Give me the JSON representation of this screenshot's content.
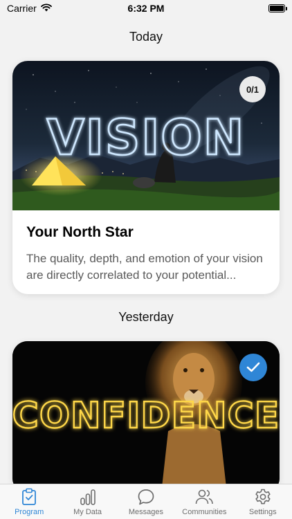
{
  "status_bar": {
    "carrier": "Carrier",
    "time": "6:32 PM"
  },
  "sections": [
    {
      "heading": "Today",
      "card": {
        "image_text": "VISION",
        "badge": "0/1",
        "title": "Your North Star",
        "description": "The quality, depth, and emotion of your vision are directly correlated to your potential..."
      }
    },
    {
      "heading": "Yesterday",
      "card": {
        "image_text": "CONFIDENCE",
        "completed": true
      }
    }
  ],
  "tab_bar": {
    "tabs": [
      {
        "label": "Program",
        "icon": "clipboard-check-icon",
        "active": true
      },
      {
        "label": "My Data",
        "icon": "bar-chart-icon",
        "active": false
      },
      {
        "label": "Messages",
        "icon": "chat-bubble-icon",
        "active": false
      },
      {
        "label": "Communities",
        "icon": "people-icon",
        "active": false
      },
      {
        "label": "Settings",
        "icon": "gear-icon",
        "active": false
      }
    ]
  },
  "colors": {
    "accent": "#2f86d6",
    "background": "#f2f2f2",
    "vision_neon": "#cfe8ff",
    "confidence_neon": "#ffd84a"
  }
}
